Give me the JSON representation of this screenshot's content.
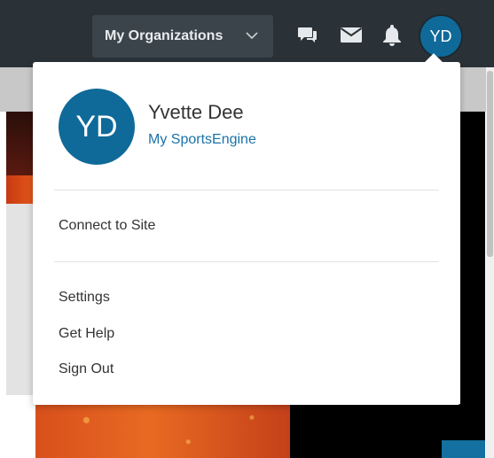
{
  "header": {
    "org_button_label": "My Organizations",
    "avatar_initials": "YD"
  },
  "icons": {
    "org_chevron": "chevron-down-icon",
    "chat": "chat-icon",
    "mail": "mail-icon",
    "bell": "bell-icon"
  },
  "user_menu": {
    "avatar_initials": "YD",
    "name": "Yvette Dee",
    "profile_link": "My SportsEngine",
    "connect_label": "Connect to Site",
    "settings_label": "Settings",
    "help_label": "Get Help",
    "signout_label": "Sign Out"
  },
  "colors": {
    "topbar": "#2a3238",
    "avatar": "#0f6a99",
    "link": "#1a73a8"
  }
}
